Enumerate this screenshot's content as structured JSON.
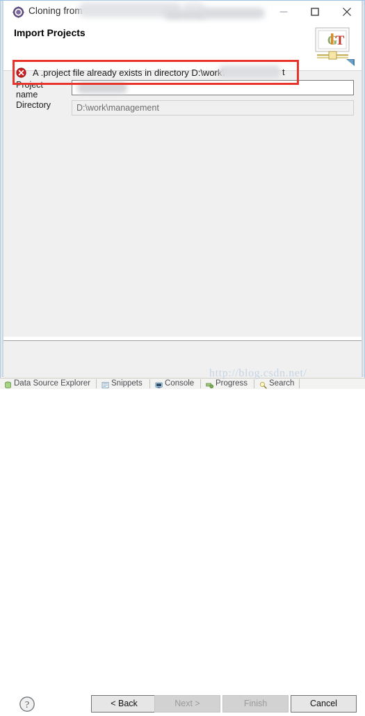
{
  "window": {
    "title": "Cloning from",
    "icon": "eclipse-wizard-icon",
    "controls": {
      "minimize": "minimize-icon",
      "maximize": "maximize-icon",
      "close": "close-icon"
    }
  },
  "header": {
    "title": "Import Projects",
    "banner_icon": "git-banner-image",
    "banner_text": "GIT",
    "error": {
      "icon": "error-icon",
      "message": "A .project file already exists in directory D:\\work\\",
      "message_tail": "t"
    }
  },
  "form": {
    "fields": [
      {
        "label": "Project name",
        "value": "",
        "readonly": false
      },
      {
        "label": "Directory",
        "value": "D:\\work\\management",
        "readonly": true
      }
    ]
  },
  "footer": {
    "help_icon": "help-icon",
    "buttons": [
      {
        "label": "< Back",
        "enabled": true
      },
      {
        "label": "Next >",
        "enabled": false
      },
      {
        "label": "Finish",
        "enabled": false
      },
      {
        "label": "Cancel",
        "enabled": true
      }
    ]
  },
  "watermark": "http://blog.csdn.net/",
  "taskbar": {
    "tabs": [
      {
        "label": "Data Source Explorer",
        "icon": "database-icon"
      },
      {
        "label": "Snippets",
        "icon": "snippets-icon"
      },
      {
        "label": "Console",
        "icon": "console-icon"
      },
      {
        "label": "Progress",
        "icon": "progress-icon"
      },
      {
        "label": "Search",
        "icon": "search-icon"
      }
    ]
  },
  "colors": {
    "annotation": "#e8352b",
    "error": "#cc2222",
    "window_border": "#9cc3e5",
    "dialog_bg": "#f0f0f0"
  }
}
